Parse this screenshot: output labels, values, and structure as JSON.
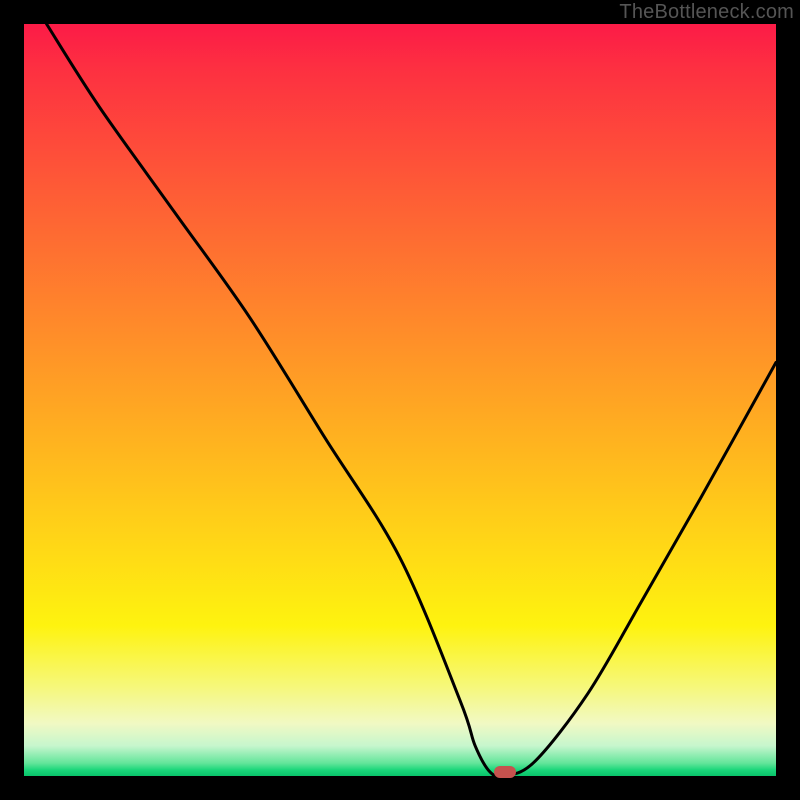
{
  "watermark": {
    "text": "TheBottleneck.com"
  },
  "colors": {
    "border": "#000000",
    "curve": "#000000",
    "marker": "#c5524e"
  },
  "chart_data": {
    "type": "line",
    "title": "",
    "xlabel": "",
    "ylabel": "",
    "xlim": [
      0,
      100
    ],
    "ylim": [
      0,
      100
    ],
    "grid": false,
    "legend": false,
    "series": [
      {
        "name": "bottleneck-curve",
        "x": [
          3,
          10,
          20,
          30,
          40,
          50,
          58,
          60,
          62,
          64,
          68,
          75,
          82,
          90,
          100
        ],
        "values": [
          100,
          89,
          75,
          61,
          45,
          29,
          10,
          4,
          0.5,
          0,
          2,
          11,
          23,
          37,
          55
        ]
      }
    ],
    "annotations": [
      {
        "name": "optimal-marker",
        "x": 64,
        "y": 0
      }
    ],
    "background_gradient": {
      "type": "vertical",
      "stops": [
        {
          "pos": 0,
          "color": "#fc1b47"
        },
        {
          "pos": 0.4,
          "color": "#ff8a2a"
        },
        {
          "pos": 0.8,
          "color": "#fef30f"
        },
        {
          "pos": 0.96,
          "color": "#c6f6cd"
        },
        {
          "pos": 1.0,
          "color": "#09c36a"
        }
      ]
    }
  }
}
